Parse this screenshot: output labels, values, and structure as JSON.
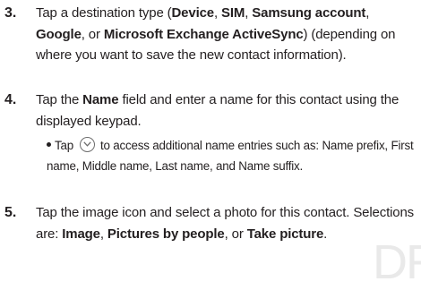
{
  "watermark": "DR",
  "steps": [
    {
      "number": "3.",
      "parts": {
        "t1": "Tap a destination type (",
        "b1": "Device",
        "t2": ", ",
        "b2": "SIM",
        "t3": ", ",
        "b3": "Samsung account",
        "t4": ", ",
        "b4": "Google",
        "t5": ", or ",
        "b5": "Microsoft Exchange ActiveSync",
        "t6": ") (depending on where you want to save the new contact information)."
      }
    },
    {
      "number": "4.",
      "parts": {
        "t1": "Tap the ",
        "b1": "Name",
        "t2": " field and enter a name for this contact using the displayed keypad."
      },
      "sub": {
        "t1": "Tap",
        "icon": "chevron-down-icon",
        "t2": "to access additional name entries such as: Name prefix, First name, Middle name, Last name, and Name suffix."
      }
    },
    {
      "number": "5.",
      "parts": {
        "t1": "Tap the image icon and select a photo for this contact. Selections are: ",
        "b1": "Image",
        "t2": ", ",
        "b2": "Pictures by people",
        "t3": ", or ",
        "b3": "Take picture",
        "t4": "."
      }
    }
  ]
}
